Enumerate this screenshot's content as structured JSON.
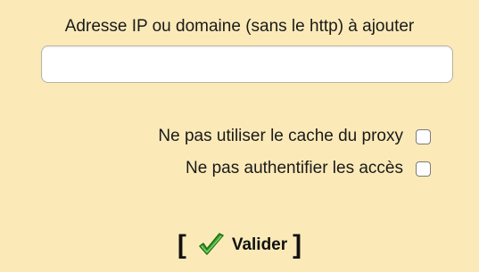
{
  "form": {
    "address_label": "Adresse IP ou domaine (sans le http) à ajouter",
    "address_value": "",
    "options": [
      {
        "label": "Ne pas utiliser le cache du proxy",
        "checked": false
      },
      {
        "label": "Ne pas authentifier les accès",
        "checked": false
      }
    ],
    "submit": {
      "bracket_open": "[",
      "label": "Valider",
      "bracket_close": "]",
      "icon": "green-checkmark-icon"
    }
  },
  "colors": {
    "background": "#fbeab8",
    "check_green": "#3aa12b"
  }
}
